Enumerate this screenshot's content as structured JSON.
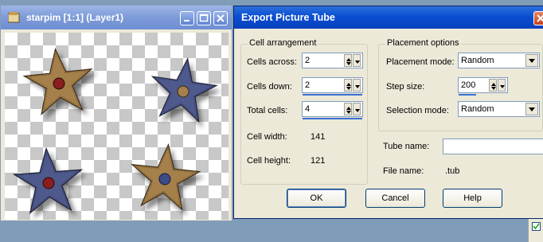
{
  "image_window": {
    "title": "starpim [1:1] (Layer1)"
  },
  "dialog": {
    "title": "Export Picture Tube",
    "cell_arrangement": {
      "group_label": "Cell arrangement",
      "cells_across_label": "Cells across:",
      "cells_across_value": "2",
      "cells_down_label": "Cells down:",
      "cells_down_value": "2",
      "total_cells_label": "Total cells:",
      "total_cells_value": "4",
      "cell_width_label": "Cell width:",
      "cell_width_value": "141",
      "cell_height_label": "Cell height:",
      "cell_height_value": "121"
    },
    "placement_options": {
      "group_label": "Placement options",
      "placement_mode_label": "Placement mode:",
      "placement_mode_value": "Random",
      "step_size_label": "Step size:",
      "step_size_value": "200",
      "selection_mode_label": "Selection mode:",
      "selection_mode_value": "Random"
    },
    "tube_name_label": "Tube name:",
    "tube_name_value": "",
    "file_name_label": "File name:",
    "file_name_value": ".tub",
    "buttons": {
      "ok": "OK",
      "cancel": "Cancel",
      "help": "Help"
    }
  },
  "icons": [
    "app-icon",
    "minimize-icon",
    "maximize-icon",
    "close-icon",
    "spin-up-icon",
    "spin-down-icon",
    "dropdown-arrow-icon",
    "checkbox-check-icon"
  ],
  "colors": {
    "dialog_title": "#0a4ed2",
    "inactive_title": "#7d9ad8",
    "dialog_face": "#ece9d8",
    "star_tan": "#a5804b",
    "star_blue": "#4f5a8c",
    "button_red": "#8a1e1e",
    "button_blue": "#3b4c88"
  }
}
